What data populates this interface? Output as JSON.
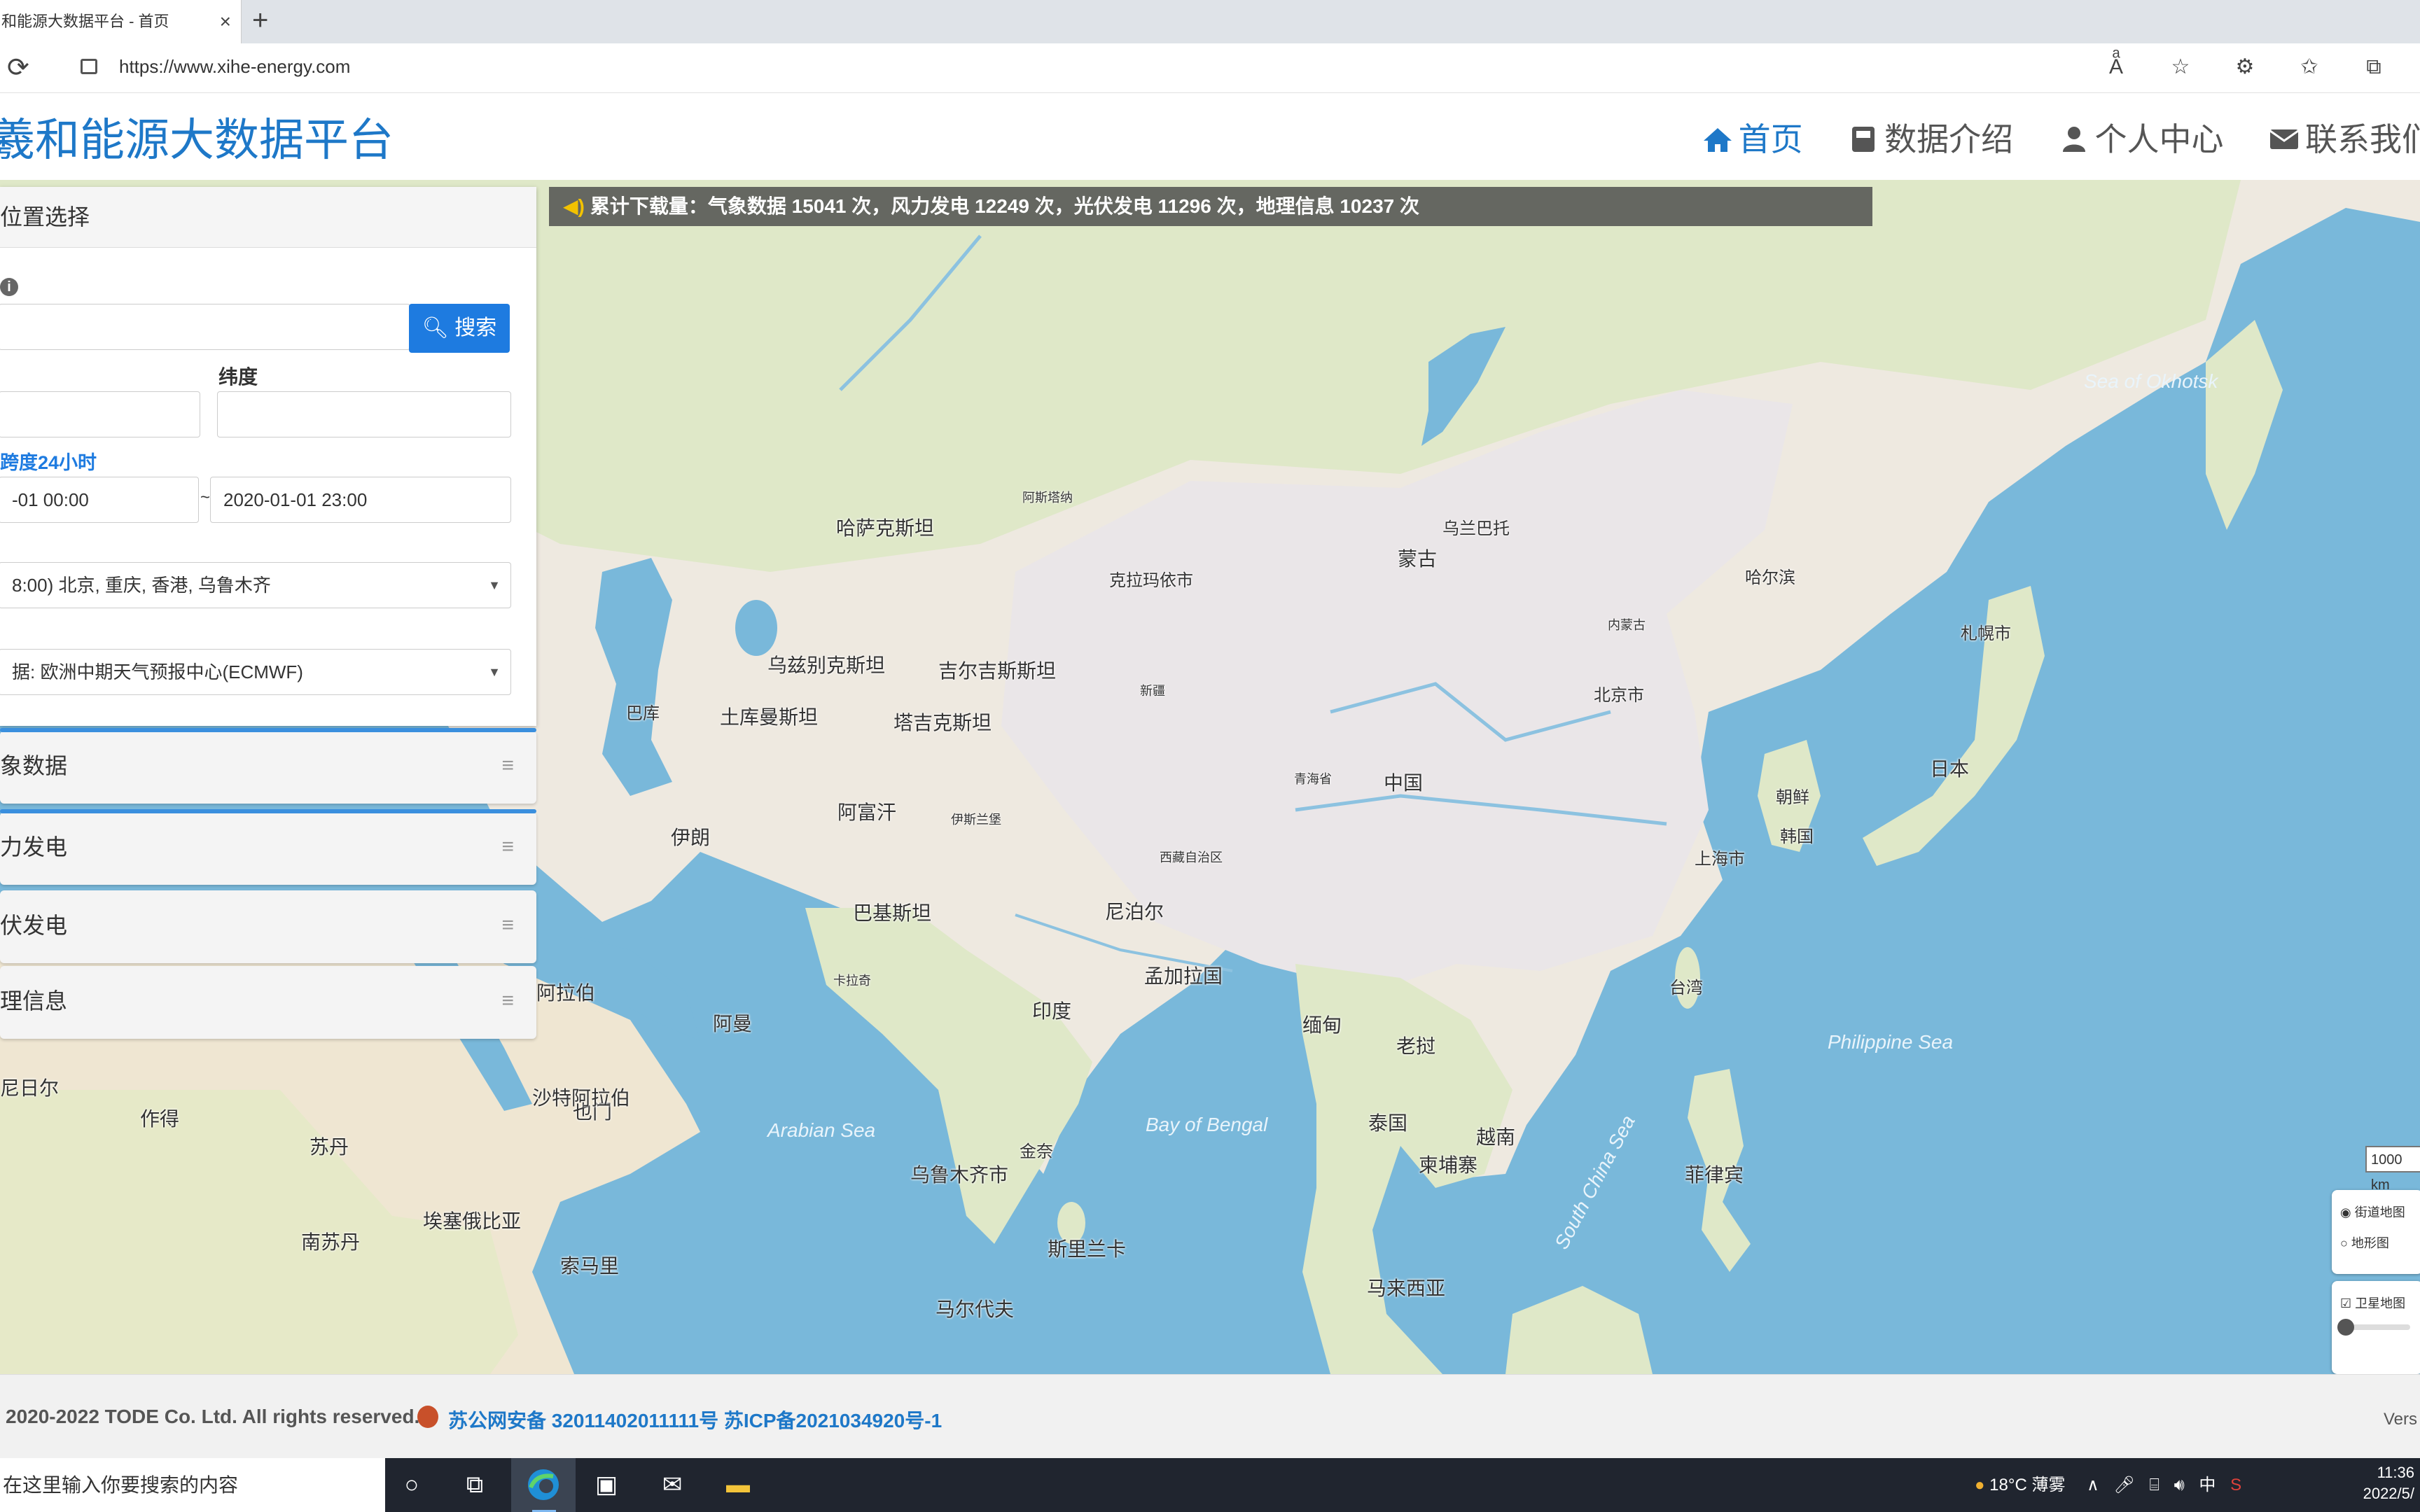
{
  "browser": {
    "tab_title": "和能源大数据平台 - 首页",
    "tab_close": "×",
    "new_tab": "+",
    "url": "https://www.xihe-energy.com"
  },
  "site": {
    "title": "羲和能源大数据平台",
    "nav": [
      {
        "label": "首页",
        "icon": "home-icon"
      },
      {
        "label": "数据介绍",
        "icon": "book-icon"
      },
      {
        "label": "个人中心",
        "icon": "user-icon"
      },
      {
        "label": "联系我们",
        "icon": "envelope-icon"
      }
    ]
  },
  "banner": {
    "text": "累计下载量：气象数据 15041 次，风力发电 12249 次，光伏发电 11296 次，地理信息 10237 次"
  },
  "panel": {
    "title": "位置选择",
    "search_button": "搜索",
    "lat_label": "纬度",
    "span_hint": "跨度24小时",
    "start_time": "-01 00:00",
    "end_time": "2020-01-01 23:00",
    "tilde": "~",
    "timezone": "8:00) 北京, 重庆, 香港, 乌鲁木齐",
    "source": "据: 欧洲中期天气预报中心(ECMWF)",
    "sections": [
      "象数据",
      "力发电",
      "伏发电",
      "理信息"
    ]
  },
  "map": {
    "labels": [
      {
        "t": "蒙古"
      },
      {
        "t": "中国"
      },
      {
        "t": "哈萨克斯坦"
      },
      {
        "t": "乌兹别克斯坦"
      },
      {
        "t": "吉尔吉斯斯坦"
      },
      {
        "t": "塔吉克斯坦"
      },
      {
        "t": "土库曼斯坦"
      },
      {
        "t": "阿富汗"
      },
      {
        "t": "巴基斯坦"
      },
      {
        "t": "伊朗"
      },
      {
        "t": "印度"
      },
      {
        "t": "尼泊尔"
      },
      {
        "t": "孟加拉国"
      },
      {
        "t": "缅甸"
      },
      {
        "t": "泰国"
      },
      {
        "t": "老挝"
      },
      {
        "t": "越南"
      },
      {
        "t": "柬埔寨"
      },
      {
        "t": "菲律宾"
      },
      {
        "t": "马来西亚"
      },
      {
        "t": "日本"
      },
      {
        "t": "韩国"
      },
      {
        "t": "朝鲜"
      },
      {
        "t": "台湾"
      },
      {
        "t": "斯里兰卡"
      },
      {
        "t": "马尔代夫"
      },
      {
        "t": "阿曼"
      },
      {
        "t": "也门"
      },
      {
        "t": "沙特阿拉伯"
      },
      {
        "t": "作得"
      },
      {
        "t": "苏丹"
      },
      {
        "t": "南苏丹"
      },
      {
        "t": "埃塞俄比亚"
      },
      {
        "t": "索马里"
      },
      {
        "t": "尼日尔"
      },
      {
        "t": "乌鲁木齐市"
      },
      {
        "t": "北京市"
      },
      {
        "t": "上海市"
      },
      {
        "t": "新疆"
      },
      {
        "t": "西藏自治区"
      },
      {
        "t": "青海省"
      },
      {
        "t": "内蒙古"
      },
      {
        "t": "哈尔滨"
      },
      {
        "t": "札幌市"
      },
      {
        "t": "巴库"
      },
      {
        "t": "伊斯兰堡"
      },
      {
        "t": "卡拉奇"
      },
      {
        "t": "阿拉伯"
      },
      {
        "t": "阿斯塔纳"
      },
      {
        "t": "乌兰巴托"
      },
      {
        "t": "金奈"
      },
      {
        "t": "克拉玛依市"
      }
    ],
    "seas": [
      "Sea of Okhotsk",
      "Philippine Sea",
      "Arabian Sea",
      "Bay of Bengal",
      "South China Sea"
    ],
    "scale": "1000 km",
    "layers": [
      "街道地图",
      "地形图"
    ],
    "satellite": "卫星地图"
  },
  "footer": {
    "copyright": "2020-2022 TODE Co. Ltd. All rights reserved.",
    "icp": "苏公网安备 32011402011111号 苏ICP备2021034920号-1",
    "version": "Vers"
  },
  "taskbar": {
    "search_placeholder": "在这里输入你要搜索的内容",
    "weather": "18°C 薄雾",
    "ime": "中",
    "time": "11:36",
    "date": "2022/5/"
  }
}
